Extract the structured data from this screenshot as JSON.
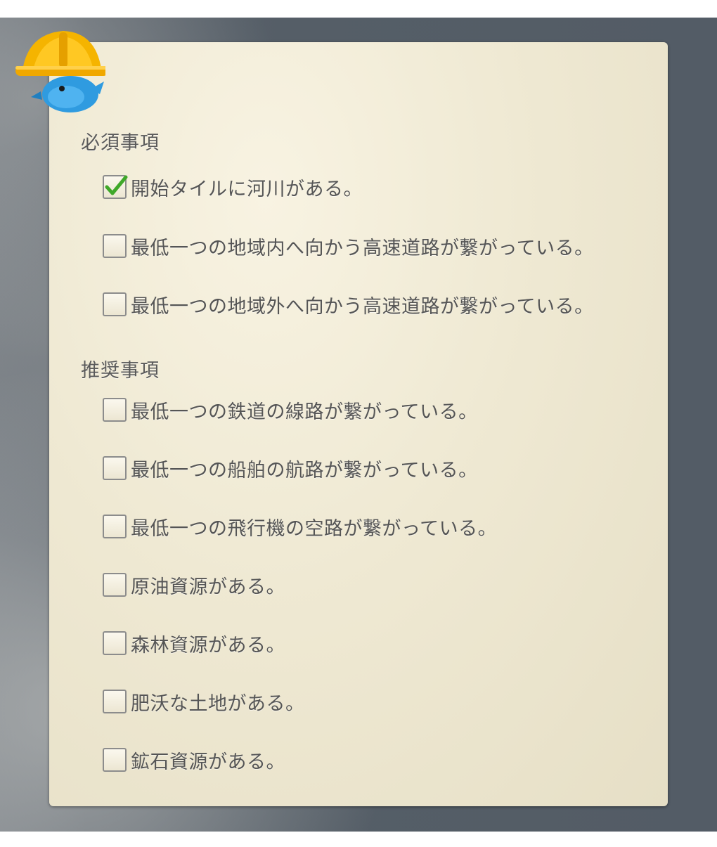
{
  "required": {
    "title": "必須事項",
    "items": [
      {
        "label": "開始タイルに河川がある。",
        "checked": true
      },
      {
        "label": "最低一つの地域内へ向かう高速道路が繋がっている。",
        "checked": false
      },
      {
        "label": "最低一つの地域外へ向かう高速道路が繋がっている。",
        "checked": false
      }
    ]
  },
  "recommended": {
    "title": "推奨事項",
    "items": [
      {
        "label": "最低一つの鉄道の線路が繋がっている。",
        "checked": false
      },
      {
        "label": "最低一つの船舶の航路が繋がっている。",
        "checked": false
      },
      {
        "label": "最低一つの飛行機の空路が繋がっている。",
        "checked": false
      },
      {
        "label": "原油資源がある。",
        "checked": false
      },
      {
        "label": "森林資源がある。",
        "checked": false
      },
      {
        "label": "肥沃な土地がある。",
        "checked": false
      },
      {
        "label": "鉱石資源がある。",
        "checked": false
      }
    ]
  },
  "icons": {
    "mascot": "bird-hardhat-icon",
    "check": "checkmark-icon"
  },
  "colors": {
    "checkmark": "#3fa82a",
    "hardhat": "#f5b400",
    "bird": "#2f9be0"
  }
}
